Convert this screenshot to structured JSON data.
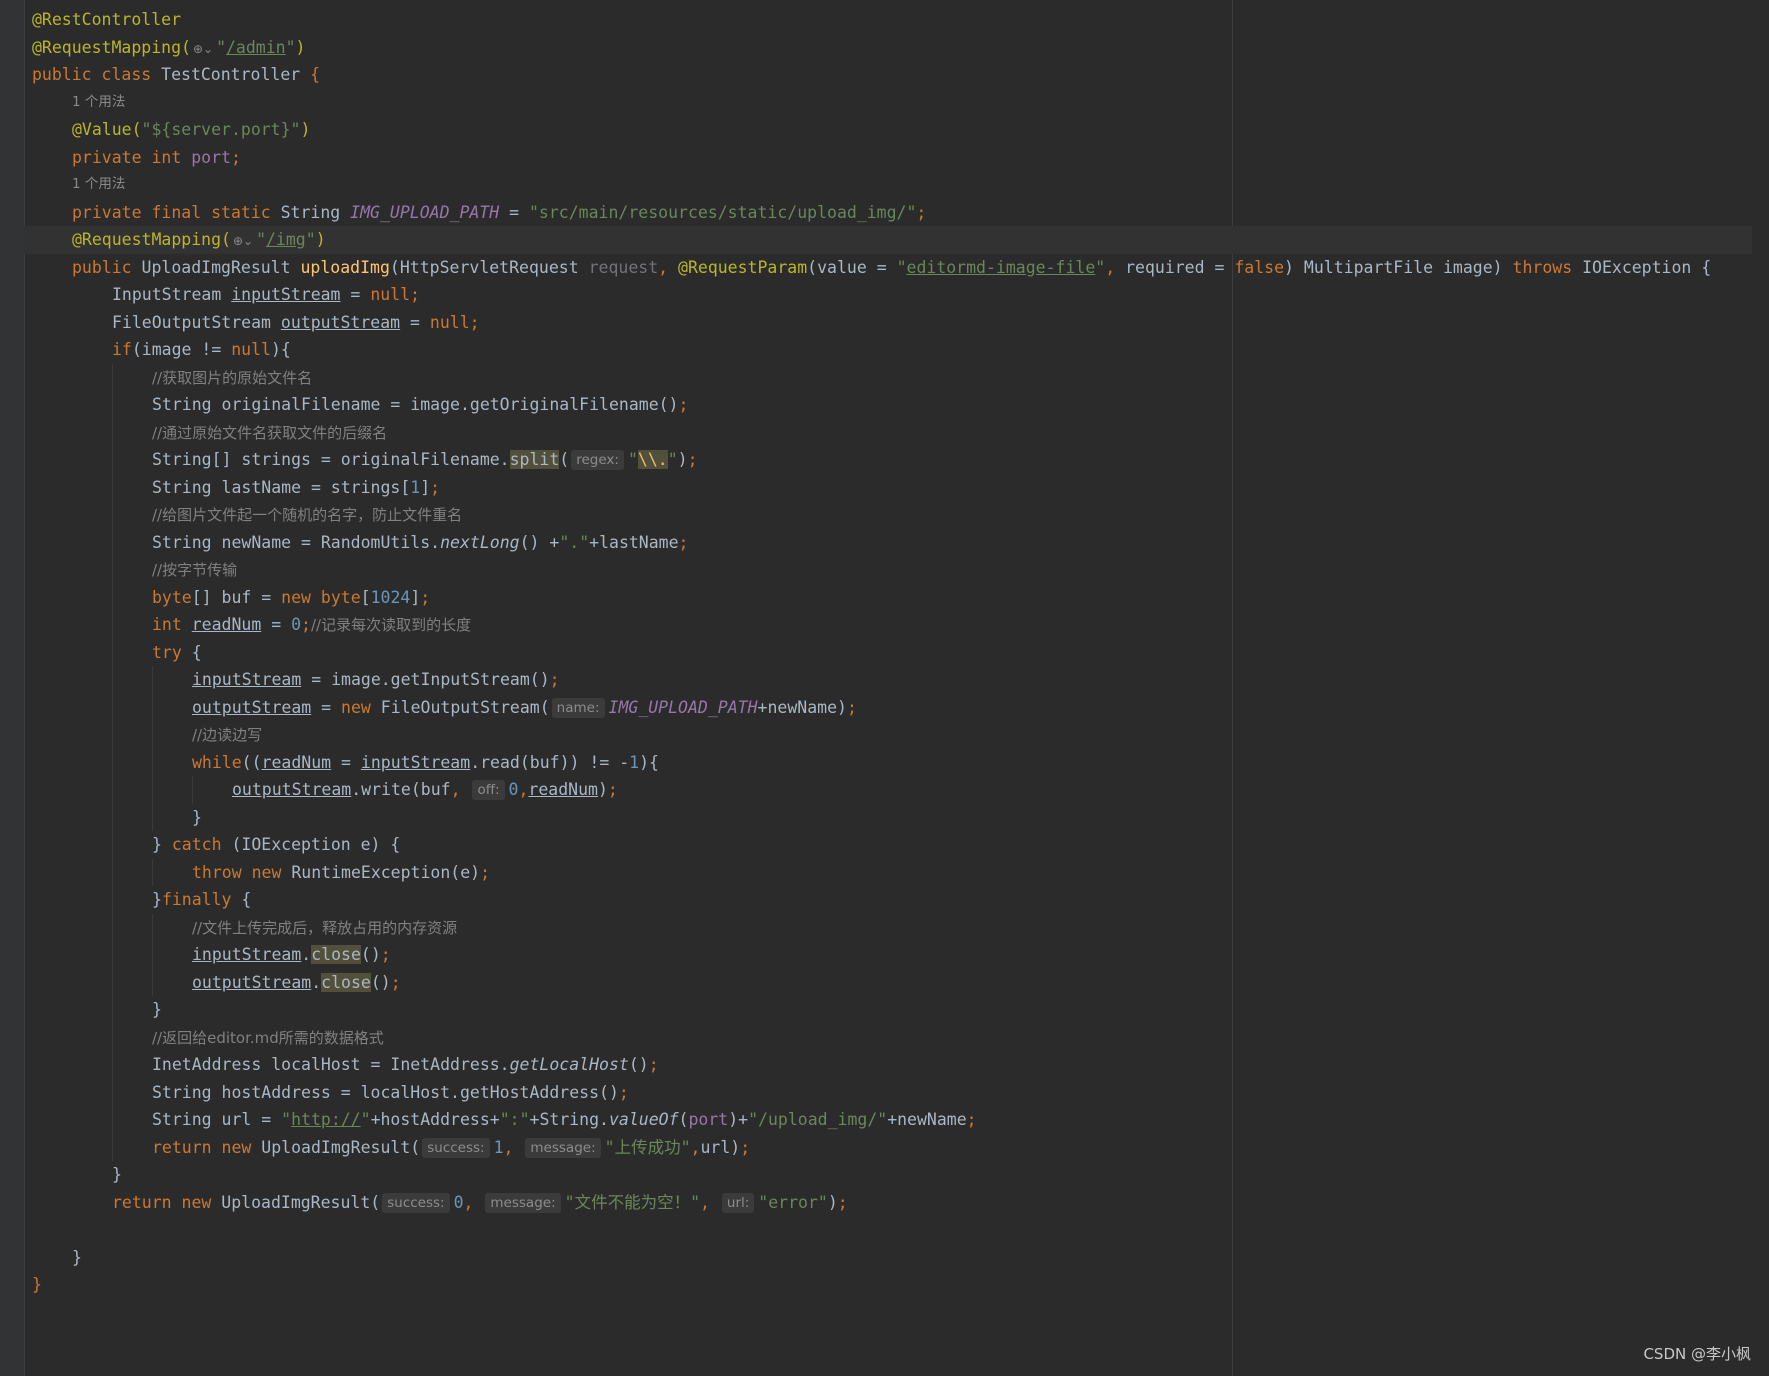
{
  "editor": {
    "usage_hints": [
      "1 个用法",
      "1 个用法"
    ],
    "lines": {
      "l1": "@RestController",
      "l2_ann": "@RequestMapping(",
      "l2_path": "/admin",
      "l3_kw": "public class ",
      "l3_name": "TestController",
      "l4_ann": "@Value(",
      "l4_str": "\"${server.port}\"",
      "l5_kw": "private int ",
      "l5_fld": "port",
      "l6_kw": "private final static ",
      "l6_type": "String ",
      "l6_fld": "IMG_UPLOAD_PATH",
      "l6_str": "\"src/main/resources/static/upload_img/\"",
      "l7_ann": "@RequestMapping(",
      "l7_path": "/img",
      "l8_public": "public ",
      "l8_type": "UploadImgResult ",
      "l8_method": "uploadImg",
      "l8_p1": "HttpServletRequest ",
      "l8_p1name": "request",
      "l8_ann": "@RequestParam",
      "l8_value": "value = ",
      "l8_valstr": "editormd-image-file",
      "l8_required": "required = ",
      "l8_false": "false",
      "l8_p2": "MultipartFile image",
      "l8_throws": "throws ",
      "l8_exc": "IOException ",
      "c1": "//获取图片的原始文件名",
      "c2": "//通过原始文件名获取文件的后缀名",
      "c3": "//给图片文件起一个随机的名字，防止文件重名",
      "c4": "//按字节传输",
      "c5": "//记录每次读取到的长度",
      "c6": "//边读边写",
      "c7": "//文件上传完成后，释放占用的内存资源",
      "c8": "//返回给editor.md所需的数据格式",
      "s_split": "\\\\.",
      "s_dot": "\".\"",
      "s_http": "http://",
      "s_colon": "\":\"",
      "s_upload": "\"/upload_img/\"",
      "s_success": "\"上传成功\"",
      "s_empty": "\"文件不能为空！\"",
      "s_error": "\"error\""
    },
    "param_hints": {
      "regex": "regex:",
      "name": "name:",
      "off": "off:",
      "success": "success:",
      "message": "message:",
      "url": "url:"
    }
  },
  "watermark": "CSDN @李小枫"
}
